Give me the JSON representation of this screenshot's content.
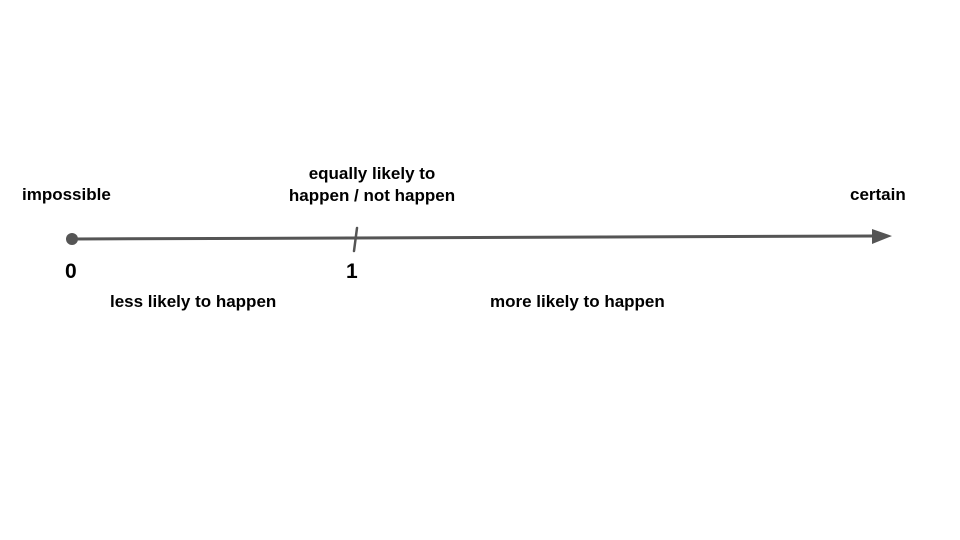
{
  "diagram": {
    "type": "probability-scale",
    "ends": {
      "left_label": "impossible",
      "right_label": "certain"
    },
    "middle_label_lines": [
      "equally likely to",
      "happen / not happen"
    ],
    "ticks": [
      "0",
      "1"
    ],
    "regions": {
      "left": "less likely to happen",
      "right": "more likely to happen"
    },
    "colors": {
      "line": "#555555",
      "text": "#000000",
      "background": "#ffffff"
    }
  }
}
